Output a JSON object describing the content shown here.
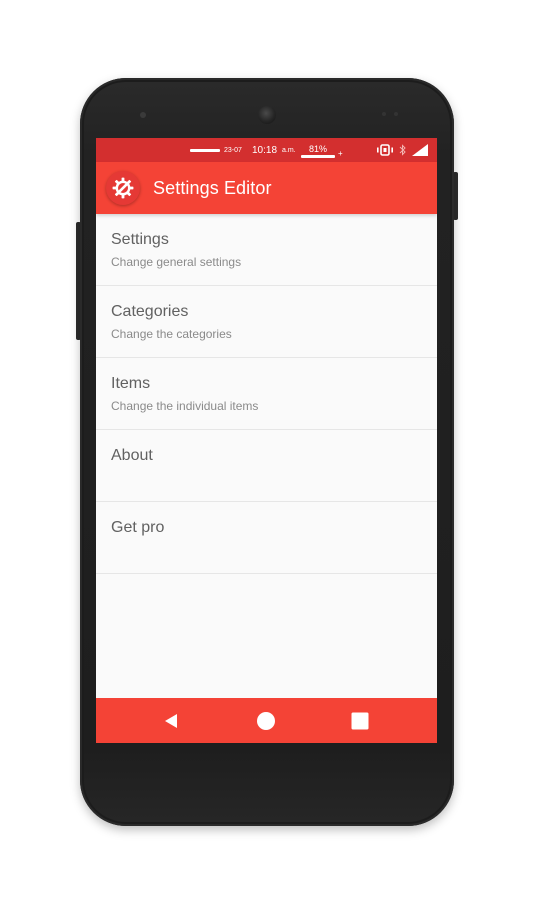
{
  "status_bar": {
    "date": "23-07",
    "time": "10:18",
    "ampm": "a.m.",
    "battery_percent": "81%",
    "charging_mark": "+",
    "icons": [
      "vibrate-icon",
      "bluetooth-icon",
      "signal-icon"
    ]
  },
  "app_bar": {
    "title": "Settings Editor",
    "logo_icon": "gear-icon"
  },
  "menu": {
    "items": [
      {
        "title": "Settings",
        "subtitle": "Change general settings"
      },
      {
        "title": "Categories",
        "subtitle": "Change the categories"
      },
      {
        "title": "Items",
        "subtitle": "Change the individual items"
      },
      {
        "title": "About",
        "subtitle": ""
      },
      {
        "title": "Get pro",
        "subtitle": ""
      }
    ]
  },
  "nav_bar": {
    "buttons": [
      "back-icon",
      "home-icon",
      "recents-icon"
    ]
  },
  "colors": {
    "primary": "#f44336",
    "primary_dark": "#d32f2f",
    "phone_body": "#1c1c1c",
    "text_primary": "#616161",
    "text_secondary": "#8a8a8a"
  }
}
